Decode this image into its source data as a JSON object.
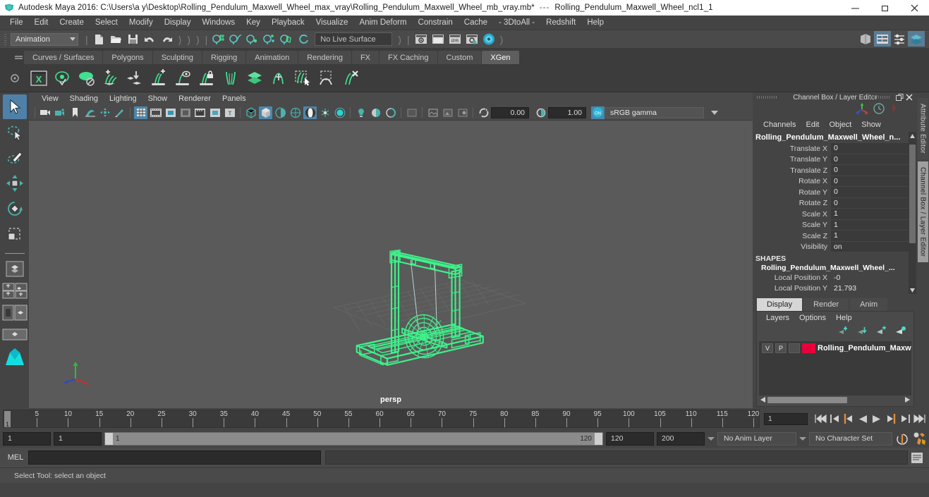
{
  "window": {
    "app_title": "Autodesk Maya 2016: C:\\Users\\a y\\Desktop\\Rolling_Pendulum_Maxwell_Wheel_max_vray\\Rolling_Pendulum_Maxwell_Wheel_mb_vray.mb*",
    "title_separator": "---",
    "selected_node": "Rolling_Pendulum_Maxwell_Wheel_ncl1_1",
    "minimize": "–",
    "maximize": "❐",
    "close": "✕"
  },
  "menubar": {
    "items": [
      {
        "label": "File"
      },
      {
        "label": "Edit"
      },
      {
        "label": "Create"
      },
      {
        "label": "Select"
      },
      {
        "label": "Modify"
      },
      {
        "label": "Display"
      },
      {
        "label": "Windows"
      },
      {
        "label": "Key"
      },
      {
        "label": "Playback"
      },
      {
        "label": "Visualize"
      },
      {
        "label": "Anim Deform"
      },
      {
        "label": "Constrain"
      },
      {
        "label": "Cache"
      },
      {
        "label": "- 3DtoAll -"
      },
      {
        "label": "Redshift"
      },
      {
        "label": "Help"
      }
    ]
  },
  "statusline": {
    "menuset_value": "Animation",
    "live_surface": "No Live Surface",
    "file_icons": [
      "new-scene-icon",
      "open-scene-icon",
      "save-scene-icon",
      "undo-icon",
      "redo-icon"
    ],
    "snap_icons": [
      "snap-to-grid-icon",
      "snap-to-curve-icon",
      "snap-to-point-icon",
      "snap-to-projected-center-icon",
      "snap-to-view-plane-icon",
      "make-live-icon"
    ],
    "render_icons": [
      "render-current-frame-icon",
      "render-sequence-icon",
      "ipr-render-icon",
      "render-settings-icon",
      "hypershade-icon"
    ],
    "right_icons": [
      "show-hide-modeling-toolkit-icon",
      "show-hide-attribute-editor-icon",
      "show-hide-tool-settings-icon",
      "show-hide-channel-box-icon"
    ]
  },
  "shelf": {
    "tabs": [
      {
        "label": "Curves / Surfaces",
        "active": false
      },
      {
        "label": "Polygons",
        "active": false
      },
      {
        "label": "Sculpting",
        "active": false
      },
      {
        "label": "Rigging",
        "active": false
      },
      {
        "label": "Animation",
        "active": false
      },
      {
        "label": "Rendering",
        "active": false
      },
      {
        "label": "FX",
        "active": false
      },
      {
        "label": "FX Caching",
        "active": false
      },
      {
        "label": "Custom",
        "active": false
      },
      {
        "label": "XGen",
        "active": true
      }
    ],
    "icons": [
      "xgen-editor-icon",
      "xgen-preview-icon",
      "xgen-disable-preview-icon",
      "xgen-add-guides-icon",
      "xgen-place-guide-icon",
      "xgen-grow-icon",
      "xgen-eye-guide-icon",
      "xgen-lock-guide-icon",
      "xgen-part-guides-icon",
      "xgen-density-icon",
      "xgen-comb-icon",
      "xgen-select-region-icon",
      "xgen-clump-icon",
      "xgen-delete-guides-icon"
    ]
  },
  "toolbox": {
    "tools": [
      {
        "name": "select-tool",
        "active": true
      },
      {
        "name": "lasso-select-tool",
        "active": false
      },
      {
        "name": "paint-select-tool",
        "active": false
      },
      {
        "name": "move-tool",
        "active": false
      },
      {
        "name": "rotate-tool",
        "active": false
      },
      {
        "name": "scale-tool",
        "active": false
      }
    ],
    "layout_buttons": [
      "single-perspective-layout-icon",
      "four-view-layout-icon",
      "persp-outliner-layout-icon",
      "persp-graph-editor-layout-icon",
      "maya-bookmark-icon"
    ]
  },
  "viewport": {
    "menu": [
      {
        "label": "View"
      },
      {
        "label": "Shading"
      },
      {
        "label": "Lighting"
      },
      {
        "label": "Show"
      },
      {
        "label": "Renderer"
      },
      {
        "label": "Panels"
      }
    ],
    "camera_label": "persp",
    "exposure_value": "0.00",
    "gamma_value": "1.00",
    "color_management": "sRGB gamma",
    "toolbar_icons": [
      "select-camera-icon",
      "camera-attributes-icon",
      "bookmark-icon",
      "image-plane-icon",
      "two-d-pan-zoom-icon",
      "grease-pencil-icon",
      "grid-icon",
      "film-gate-icon",
      "resolution-gate-icon",
      "gate-mask-icon",
      "film-origin-icon",
      "safe-action-icon",
      "title-safe-icon",
      "wireframe-icon",
      "smooth-shade-all-icon",
      "smooth-shade-selected-icon",
      "flat-shade-icon",
      "wireframe-on-shaded-icon",
      "xray-icon",
      "xray-joints-icon",
      "use-default-lighting-icon",
      "use-all-lights-icon",
      "shadows-icon",
      "ambient-occlusion-icon",
      "motion-blur-icon",
      "multisample-icon",
      "isolate-select-icon",
      "display-texture-icon",
      "exposure-icon",
      "gamma-icon",
      "color-management-icon"
    ]
  },
  "channelbox": {
    "panel_title": "Channel Box / Layer Editor",
    "menu": [
      {
        "label": "Channels"
      },
      {
        "label": "Edit"
      },
      {
        "label": "Object"
      },
      {
        "label": "Show"
      }
    ],
    "node_name": "Rolling_Pendulum_Maxwell_Wheel_n...",
    "attributes": [
      {
        "label": "Translate X",
        "value": "0"
      },
      {
        "label": "Translate Y",
        "value": "0"
      },
      {
        "label": "Translate Z",
        "value": "0"
      },
      {
        "label": "Rotate X",
        "value": "0"
      },
      {
        "label": "Rotate Y",
        "value": "0"
      },
      {
        "label": "Rotate Z",
        "value": "0"
      },
      {
        "label": "Scale X",
        "value": "1"
      },
      {
        "label": "Scale Y",
        "value": "1"
      },
      {
        "label": "Scale Z",
        "value": "1"
      },
      {
        "label": "Visibility",
        "value": "on"
      }
    ],
    "shapes_header": "SHAPES",
    "shape_node": "Rolling_Pendulum_Maxwell_Wheel_...",
    "shape_attributes": [
      {
        "label": "Local Position X",
        "value": "-0"
      },
      {
        "label": "Local Position Y",
        "value": "21.793"
      }
    ]
  },
  "layereditor": {
    "tabs": [
      {
        "label": "Display",
        "active": true
      },
      {
        "label": "Render",
        "active": false
      },
      {
        "label": "Anim",
        "active": false
      }
    ],
    "menu": [
      {
        "label": "Layers"
      },
      {
        "label": "Options"
      },
      {
        "label": "Help"
      }
    ],
    "buttons": [
      "move-layer-up-icon",
      "move-layer-down-icon",
      "create-new-layer-icon",
      "create-layer-from-selected-icon"
    ],
    "layers": [
      {
        "visibility": "V",
        "playback": "P",
        "shading": "",
        "color": "#e8003c",
        "name": "Rolling_Pendulum_Maxw"
      }
    ]
  },
  "docktabs": {
    "attribute_editor": "Attribute Editor",
    "channel_box": "Channel Box / Layer Editor"
  },
  "timeline": {
    "ticks": [
      5,
      10,
      15,
      20,
      25,
      30,
      35,
      40,
      45,
      50,
      55,
      60,
      65,
      70,
      75,
      80,
      85,
      90,
      95,
      100,
      105,
      110,
      115,
      120
    ],
    "range_start": 1,
    "range_end": 120,
    "current_frame": "1",
    "current_frame_field": "1",
    "playback_buttons": [
      "go-to-start-icon",
      "step-back-frame-icon",
      "step-back-key-icon",
      "play-backwards-icon",
      "play-forwards-icon",
      "step-forward-key-icon",
      "step-forward-frame-icon",
      "go-to-end-icon"
    ]
  },
  "rangeslider": {
    "anim_start": "1",
    "playback_start": "1",
    "slider_low": "1",
    "slider_high": "120",
    "playback_end": "120",
    "anim_end": "200",
    "anim_layer": "No Anim Layer",
    "character_set": "No Character Set",
    "right_icons": [
      "auto-key-icon",
      "animation-preferences-icon"
    ]
  },
  "commandline": {
    "language_label": "MEL",
    "input_value": "",
    "output_value": "",
    "script-editor-icon": "script-editor-icon"
  },
  "helpline": {
    "message": "Select Tool: select an object"
  },
  "colors": {
    "wireframe_green": "#3ff08a",
    "accent_blue": "#4b87ad",
    "teal_icon": "#49b3b0",
    "layer_red": "#e8003c",
    "background": "#444444",
    "viewport_bg": "#5a5a5a"
  }
}
